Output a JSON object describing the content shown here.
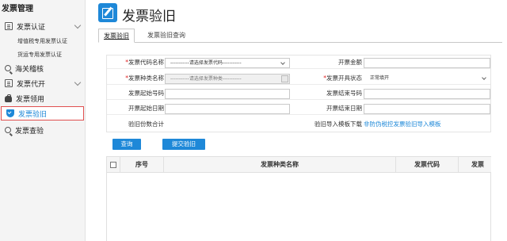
{
  "sidebar": {
    "title": "发票管理",
    "items": [
      {
        "label": "发票认证",
        "icon": "document-icon"
      },
      {
        "label": "增值税专用发票认证"
      },
      {
        "label": "货运专用发票认证"
      },
      {
        "label": "海关稽核",
        "icon": "search-icon"
      },
      {
        "label": "发票代开",
        "icon": "document-icon"
      },
      {
        "label": "发票领用",
        "icon": "bag-icon"
      },
      {
        "label": "发票验旧",
        "icon": "shield-icon"
      },
      {
        "label": "发票查验",
        "icon": "search-icon"
      }
    ]
  },
  "header": {
    "title": "发票验旧",
    "icon": "edit-icon"
  },
  "tabs": [
    {
      "label": "发票验旧"
    },
    {
      "label": "发票验旧查询"
    }
  ],
  "form": {
    "code_name_label": "发票代码名称",
    "code_name_value": "-----------请选择发票代码-----------",
    "amount_label": "开票金额",
    "amount_value": "",
    "type_name_label": "发票种类名称",
    "type_name_value": "-----------请选择发票种类-----------",
    "status_label": "发票开具状态",
    "status_value": "正常填开",
    "start_no_label": "发票起始号码",
    "start_no_value": "",
    "end_no_label": "发票结束号码",
    "end_no_value": "",
    "start_date_label": "开票起始日期",
    "start_date_value": "",
    "end_date_label": "开票结束日期",
    "end_date_value": "",
    "total_label": "验旧份数合计",
    "template_label": "验旧导入模板下载",
    "template_link": "非防伪税控发票验旧导入模板"
  },
  "buttons": {
    "query": "查询",
    "submit": "提交验旧"
  },
  "table": {
    "headers": [
      "序号",
      "发票种类名称",
      "发票代码",
      "发票"
    ]
  },
  "colors": {
    "accent": "#1e88d8",
    "active_border": "#e05050",
    "required": "#e02020"
  }
}
